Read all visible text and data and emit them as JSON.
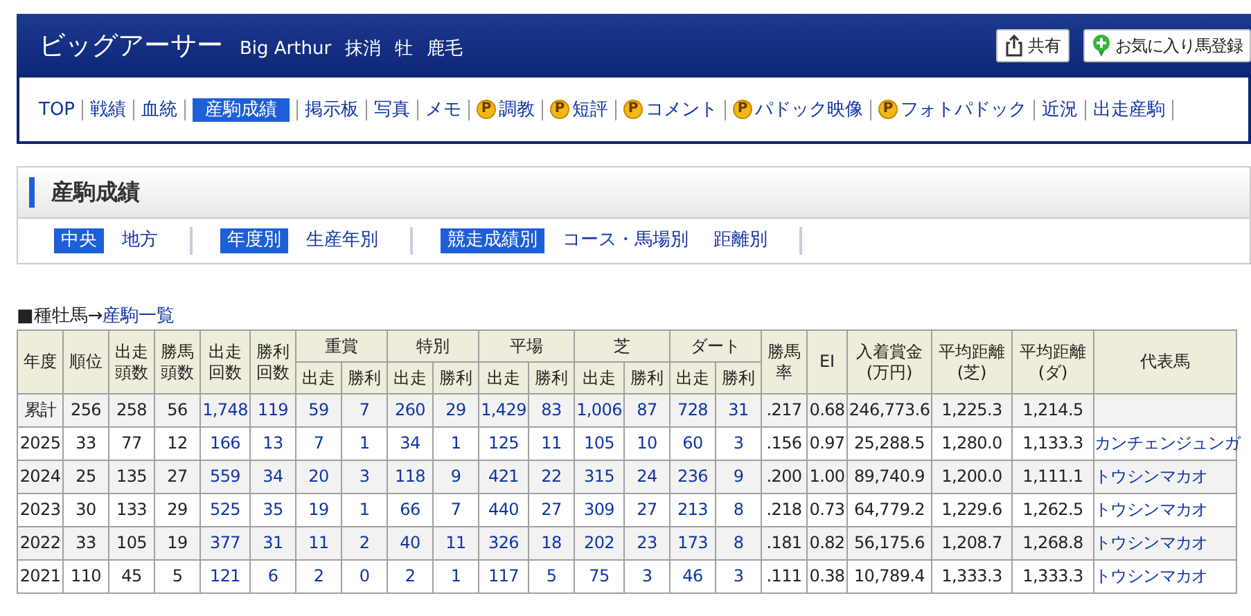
{
  "header": {
    "title": "ビッグアーサー",
    "subtitle": [
      "Big Arthur",
      "抹消",
      "牡",
      "鹿毛"
    ],
    "buttons": [
      {
        "kind": "share",
        "label": "共有"
      },
      {
        "kind": "favorite",
        "label": "お気に入り馬登録"
      }
    ]
  },
  "nav": [
    {
      "label": "TOP",
      "selected": false
    },
    {
      "label": "戦績",
      "selected": false
    },
    {
      "label": "血統",
      "selected": false
    },
    {
      "label": "産駒成績",
      "selected": true
    },
    {
      "label": "掲示板",
      "selected": false
    },
    {
      "label": "写真",
      "selected": false
    },
    {
      "label": "メモ",
      "selected": false
    },
    {
      "label": "調教",
      "selected": false,
      "badge": "P"
    },
    {
      "label": "短評",
      "selected": false,
      "badge": "P"
    },
    {
      "label": "コメント",
      "selected": false,
      "badge": "P"
    },
    {
      "label": "パドック映像",
      "selected": false,
      "badge": "P"
    },
    {
      "label": "フォトパドック",
      "selected": false,
      "badge": "P"
    },
    {
      "label": "近況",
      "selected": false
    },
    {
      "label": "出走産駒",
      "selected": false
    }
  ],
  "section_title": "産駒成績",
  "filters": [
    [
      {
        "label": "中央",
        "selected": true
      },
      {
        "label": "地方",
        "selected": false
      }
    ],
    [
      {
        "label": "年度別",
        "selected": true
      },
      {
        "label": "生産年別",
        "selected": false
      }
    ],
    [
      {
        "label": "競走成績別",
        "selected": true
      },
      {
        "label": "コース・馬場別",
        "selected": false
      },
      {
        "label": "距離別",
        "selected": false
      }
    ]
  ],
  "breadcrumb": {
    "text": "■種牡馬→",
    "link": "産駒一覧"
  },
  "table": {
    "columns": [
      {
        "label": "年度",
        "kind": "text"
      },
      {
        "label": "順位",
        "kind": "text"
      },
      {
        "label": "出走頭数",
        "kind": "text"
      },
      {
        "label": "勝馬頭数",
        "kind": "text"
      },
      {
        "label": "出走回数",
        "kind": "link"
      },
      {
        "label": "勝利回数",
        "kind": "link"
      },
      {
        "label": "重賞",
        "colspan": 2,
        "children": [
          {
            "label": "出走",
            "kind": "link"
          },
          {
            "label": "勝利",
            "kind": "link"
          }
        ]
      },
      {
        "label": "特別",
        "colspan": 2,
        "children": [
          {
            "label": "出走",
            "kind": "link"
          },
          {
            "label": "勝利",
            "kind": "link"
          }
        ]
      },
      {
        "label": "平場",
        "colspan": 2,
        "children": [
          {
            "label": "出走",
            "kind": "link"
          },
          {
            "label": "勝利",
            "kind": "link"
          }
        ]
      },
      {
        "label": "芝",
        "colspan": 2,
        "children": [
          {
            "label": "出走",
            "kind": "link"
          },
          {
            "label": "勝利",
            "kind": "link"
          }
        ]
      },
      {
        "label": "ダート",
        "colspan": 2,
        "children": [
          {
            "label": "出走",
            "kind": "link"
          },
          {
            "label": "勝利",
            "kind": "link"
          }
        ]
      },
      {
        "label": "勝馬率",
        "kind": "text"
      },
      {
        "label": "EI",
        "kind": "text"
      },
      {
        "label": "入着賞金\n(万円)",
        "kind": "text"
      },
      {
        "label": "平均距離\n(芝)",
        "kind": "text"
      },
      {
        "label": "平均距離\n(ダ)",
        "kind": "text"
      },
      {
        "label": "代表馬",
        "kind": "link"
      }
    ],
    "rows": [
      {
        "cells": [
          "累計",
          "256",
          "258",
          "56",
          "1,748",
          "119",
          "59",
          "7",
          "260",
          "29",
          "1,429",
          "83",
          "1,006",
          "87",
          "728",
          "31",
          ".217",
          "0.68",
          "246,773.6",
          "1,225.3",
          "1,214.5"
        ]
      },
      {
        "cells": [
          "2025",
          "33",
          "77",
          "12",
          "166",
          "13",
          "7",
          "1",
          "34",
          "1",
          "125",
          "11",
          "105",
          "10",
          "60",
          "3",
          ".156",
          "0.97",
          "25,288.5",
          "1,280.0",
          "1,133.3",
          "カンチェンジュンガ"
        ]
      },
      {
        "cells": [
          "2024",
          "25",
          "135",
          "27",
          "559",
          "34",
          "20",
          "3",
          "118",
          "9",
          "421",
          "22",
          "315",
          "24",
          "236",
          "9",
          ".200",
          "1.00",
          "89,740.9",
          "1,200.0",
          "1,111.1",
          "トウシンマカオ"
        ]
      },
      {
        "cells": [
          "2023",
          "30",
          "133",
          "29",
          "525",
          "35",
          "19",
          "1",
          "66",
          "7",
          "440",
          "27",
          "309",
          "27",
          "213",
          "8",
          ".218",
          "0.73",
          "64,779.2",
          "1,229.6",
          "1,262.5",
          "トウシンマカオ"
        ]
      },
      {
        "cells": [
          "2022",
          "33",
          "105",
          "19",
          "377",
          "31",
          "11",
          "2",
          "40",
          "11",
          "326",
          "18",
          "202",
          "23",
          "173",
          "8",
          ".181",
          "0.82",
          "56,175.6",
          "1,208.7",
          "1,268.8",
          "トウシンマカオ"
        ]
      },
      {
        "cells": [
          "2021",
          "110",
          "45",
          "5",
          "121",
          "6",
          "2",
          "0",
          "2",
          "1",
          "117",
          "5",
          "75",
          "3",
          "46",
          "3",
          ".111",
          "0.38",
          "10,789.4",
          "1,333.3",
          "1,333.3",
          "トウシンマカオ"
        ]
      }
    ]
  }
}
